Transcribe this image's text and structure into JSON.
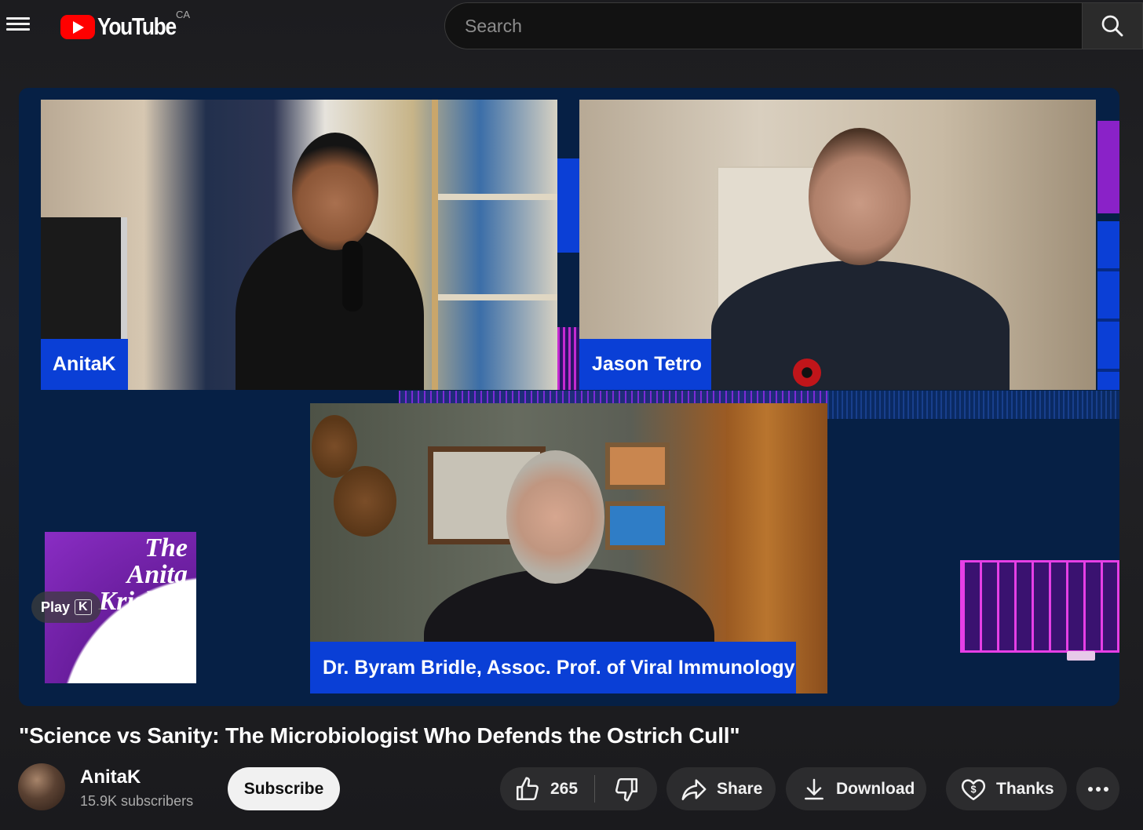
{
  "header": {
    "logo_text": "YouTube",
    "country_code": "CA",
    "search_placeholder": "Search"
  },
  "video": {
    "participants": [
      {
        "name": "AnitaK"
      },
      {
        "name": "Jason Tetro"
      },
      {
        "name": "Dr. Byram Bridle, Assoc. Prof. of Viral Immunology"
      }
    ],
    "show_logo_text": "The Anita Krishna Show",
    "play_later_label": "Play",
    "play_later_key": "K"
  },
  "meta": {
    "title": "\"Science vs Sanity: The Microbiologist Who Defends the Ostrich Cull\"",
    "channel_name": "AnitaK",
    "subscribers": "15.9K subscribers",
    "subscribe_label": "Subscribe",
    "like_count": "265",
    "share_label": "Share",
    "download_label": "Download",
    "thanks_label": "Thanks"
  },
  "colors": {
    "brand_red": "#ff0000",
    "player_bg": "#062045",
    "name_tag_blue": "#0a3fd6",
    "accent_magenta": "#d12bd6"
  },
  "icons": [
    "menu-icon",
    "youtube-logo-icon",
    "search-icon",
    "like-icon",
    "dislike-icon",
    "share-icon",
    "download-icon",
    "thanks-icon",
    "more-icon"
  ]
}
